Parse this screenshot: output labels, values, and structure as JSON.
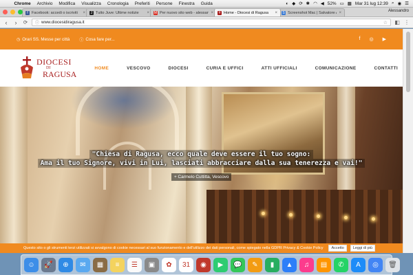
{
  "menubar": {
    "app": "Chrome",
    "items": [
      "Archivio",
      "Modifica",
      "Visualizza",
      "Cronologia",
      "Preferiti",
      "Persone",
      "Finestra",
      "Guida"
    ],
    "battery": "52%",
    "datetime": "Mar 31 lug  12:39"
  },
  "browser": {
    "tabs": [
      {
        "label": "Facebook: accedi o iscriviti",
        "favicon_color": "#3b5998",
        "favicon_glyph": "f"
      },
      {
        "label": "Tutto Juve: Ultime notizie",
        "favicon_color": "#222222",
        "favicon_glyph": "J"
      },
      {
        "label": "Per nuovo sito web - alessan",
        "favicon_color": "#d93025",
        "favicon_glyph": "M"
      },
      {
        "label": "Home - Diocesi di Ragusa",
        "favicon_color": "#a81e1e",
        "favicon_glyph": "✝",
        "active": true
      },
      {
        "label": "Screenshot Mac | Salvatore Ar",
        "favicon_color": "#3a7bd5",
        "favicon_glyph": "S"
      }
    ],
    "user": "Alessandro",
    "url": "www.diocesidiragusa.it"
  },
  "site": {
    "topbar": {
      "info1": "Orari SS. Messe per città",
      "info2": "Cosa fare per...",
      "social": [
        "facebook-icon",
        "instagram-icon",
        "youtube-icon"
      ]
    },
    "logo": {
      "line1": "DIOCESI",
      "line2": "DI",
      "line3": "RAGUSA"
    },
    "nav": [
      {
        "label": "HOME",
        "active": true
      },
      {
        "label": "VESCOVO"
      },
      {
        "label": "DIOCESI"
      },
      {
        "label": "CURIA E UFFICI"
      },
      {
        "label": "ATTI UFFICIALI"
      },
      {
        "label": "COMUNICAZIONE"
      },
      {
        "label": "CONTATTI"
      }
    ],
    "hero": {
      "quote_line1": "\"Chiesa di Ragusa, ecco quale deve essere il tuo sogno:",
      "quote_line2": "Ama il tuo Signore, vivi in Lui, lasciati abbracciare dalla sua tenerezza e vai!\"",
      "author": "+ Carmelo Cuttitta, Vescovo"
    },
    "cookie": {
      "text": "Questo sito o gli strumenti terzi utilizzati si avvalgono di cookie necessari al suo funzionamento e dell'utilizzo dei dati personali, come spiegato nella GDPR Privacy & Cookie Policy",
      "accept": "Accetto",
      "read_more": "Leggi di più"
    }
  },
  "dock": [
    {
      "name": "finder-icon",
      "color": "#3d8ee8",
      "glyph": "☺"
    },
    {
      "name": "launchpad-icon",
      "color": "#6b7a8f",
      "glyph": "🚀"
    },
    {
      "name": "safari-icon",
      "color": "#2f8ae5",
      "glyph": "⊕"
    },
    {
      "name": "mail-icon",
      "color": "#5aa9f0",
      "glyph": "✉"
    },
    {
      "name": "preview-icon",
      "color": "#8a6c45",
      "glyph": "▦"
    },
    {
      "name": "notes-icon",
      "color": "#f4d35e",
      "glyph": "≡"
    },
    {
      "name": "reminders-icon",
      "color": "#fafafa",
      "glyph": "☰"
    },
    {
      "name": "photos-app-icon",
      "color": "#8a8a8a",
      "glyph": "▣"
    },
    {
      "name": "photos-icon",
      "color": "#ffffff",
      "glyph": "✿"
    },
    {
      "name": "calendar-icon",
      "color": "#ffffff",
      "glyph": "31"
    },
    {
      "name": "photo-booth-icon",
      "color": "#c0392b",
      "glyph": "◉"
    },
    {
      "name": "facetime-icon",
      "color": "#2ecc71",
      "glyph": "▶"
    },
    {
      "name": "messages-icon",
      "color": "#34c759",
      "glyph": "💬"
    },
    {
      "name": "pages-icon",
      "color": "#f39c12",
      "glyph": "✎"
    },
    {
      "name": "numbers-icon",
      "color": "#27ae60",
      "glyph": "▮"
    },
    {
      "name": "keynote-icon",
      "color": "#2d7ff9",
      "glyph": "▲"
    },
    {
      "name": "itunes-icon",
      "color": "#fc3c8d",
      "glyph": "♫"
    },
    {
      "name": "books-icon",
      "color": "#ff9500",
      "glyph": "▤"
    },
    {
      "name": "whatsapp-icon",
      "color": "#25d366",
      "glyph": "✆"
    },
    {
      "name": "app-store-icon",
      "color": "#1d8cf8",
      "glyph": "A"
    },
    {
      "name": "chrome-icon",
      "color": "#4285f4",
      "glyph": "◎"
    },
    {
      "name": "trash-icon",
      "color": "#dfe3e8",
      "glyph": "🗑"
    }
  ],
  "colors": {
    "accent": "#f08a1f",
    "brand_red": "#a81e1e"
  }
}
